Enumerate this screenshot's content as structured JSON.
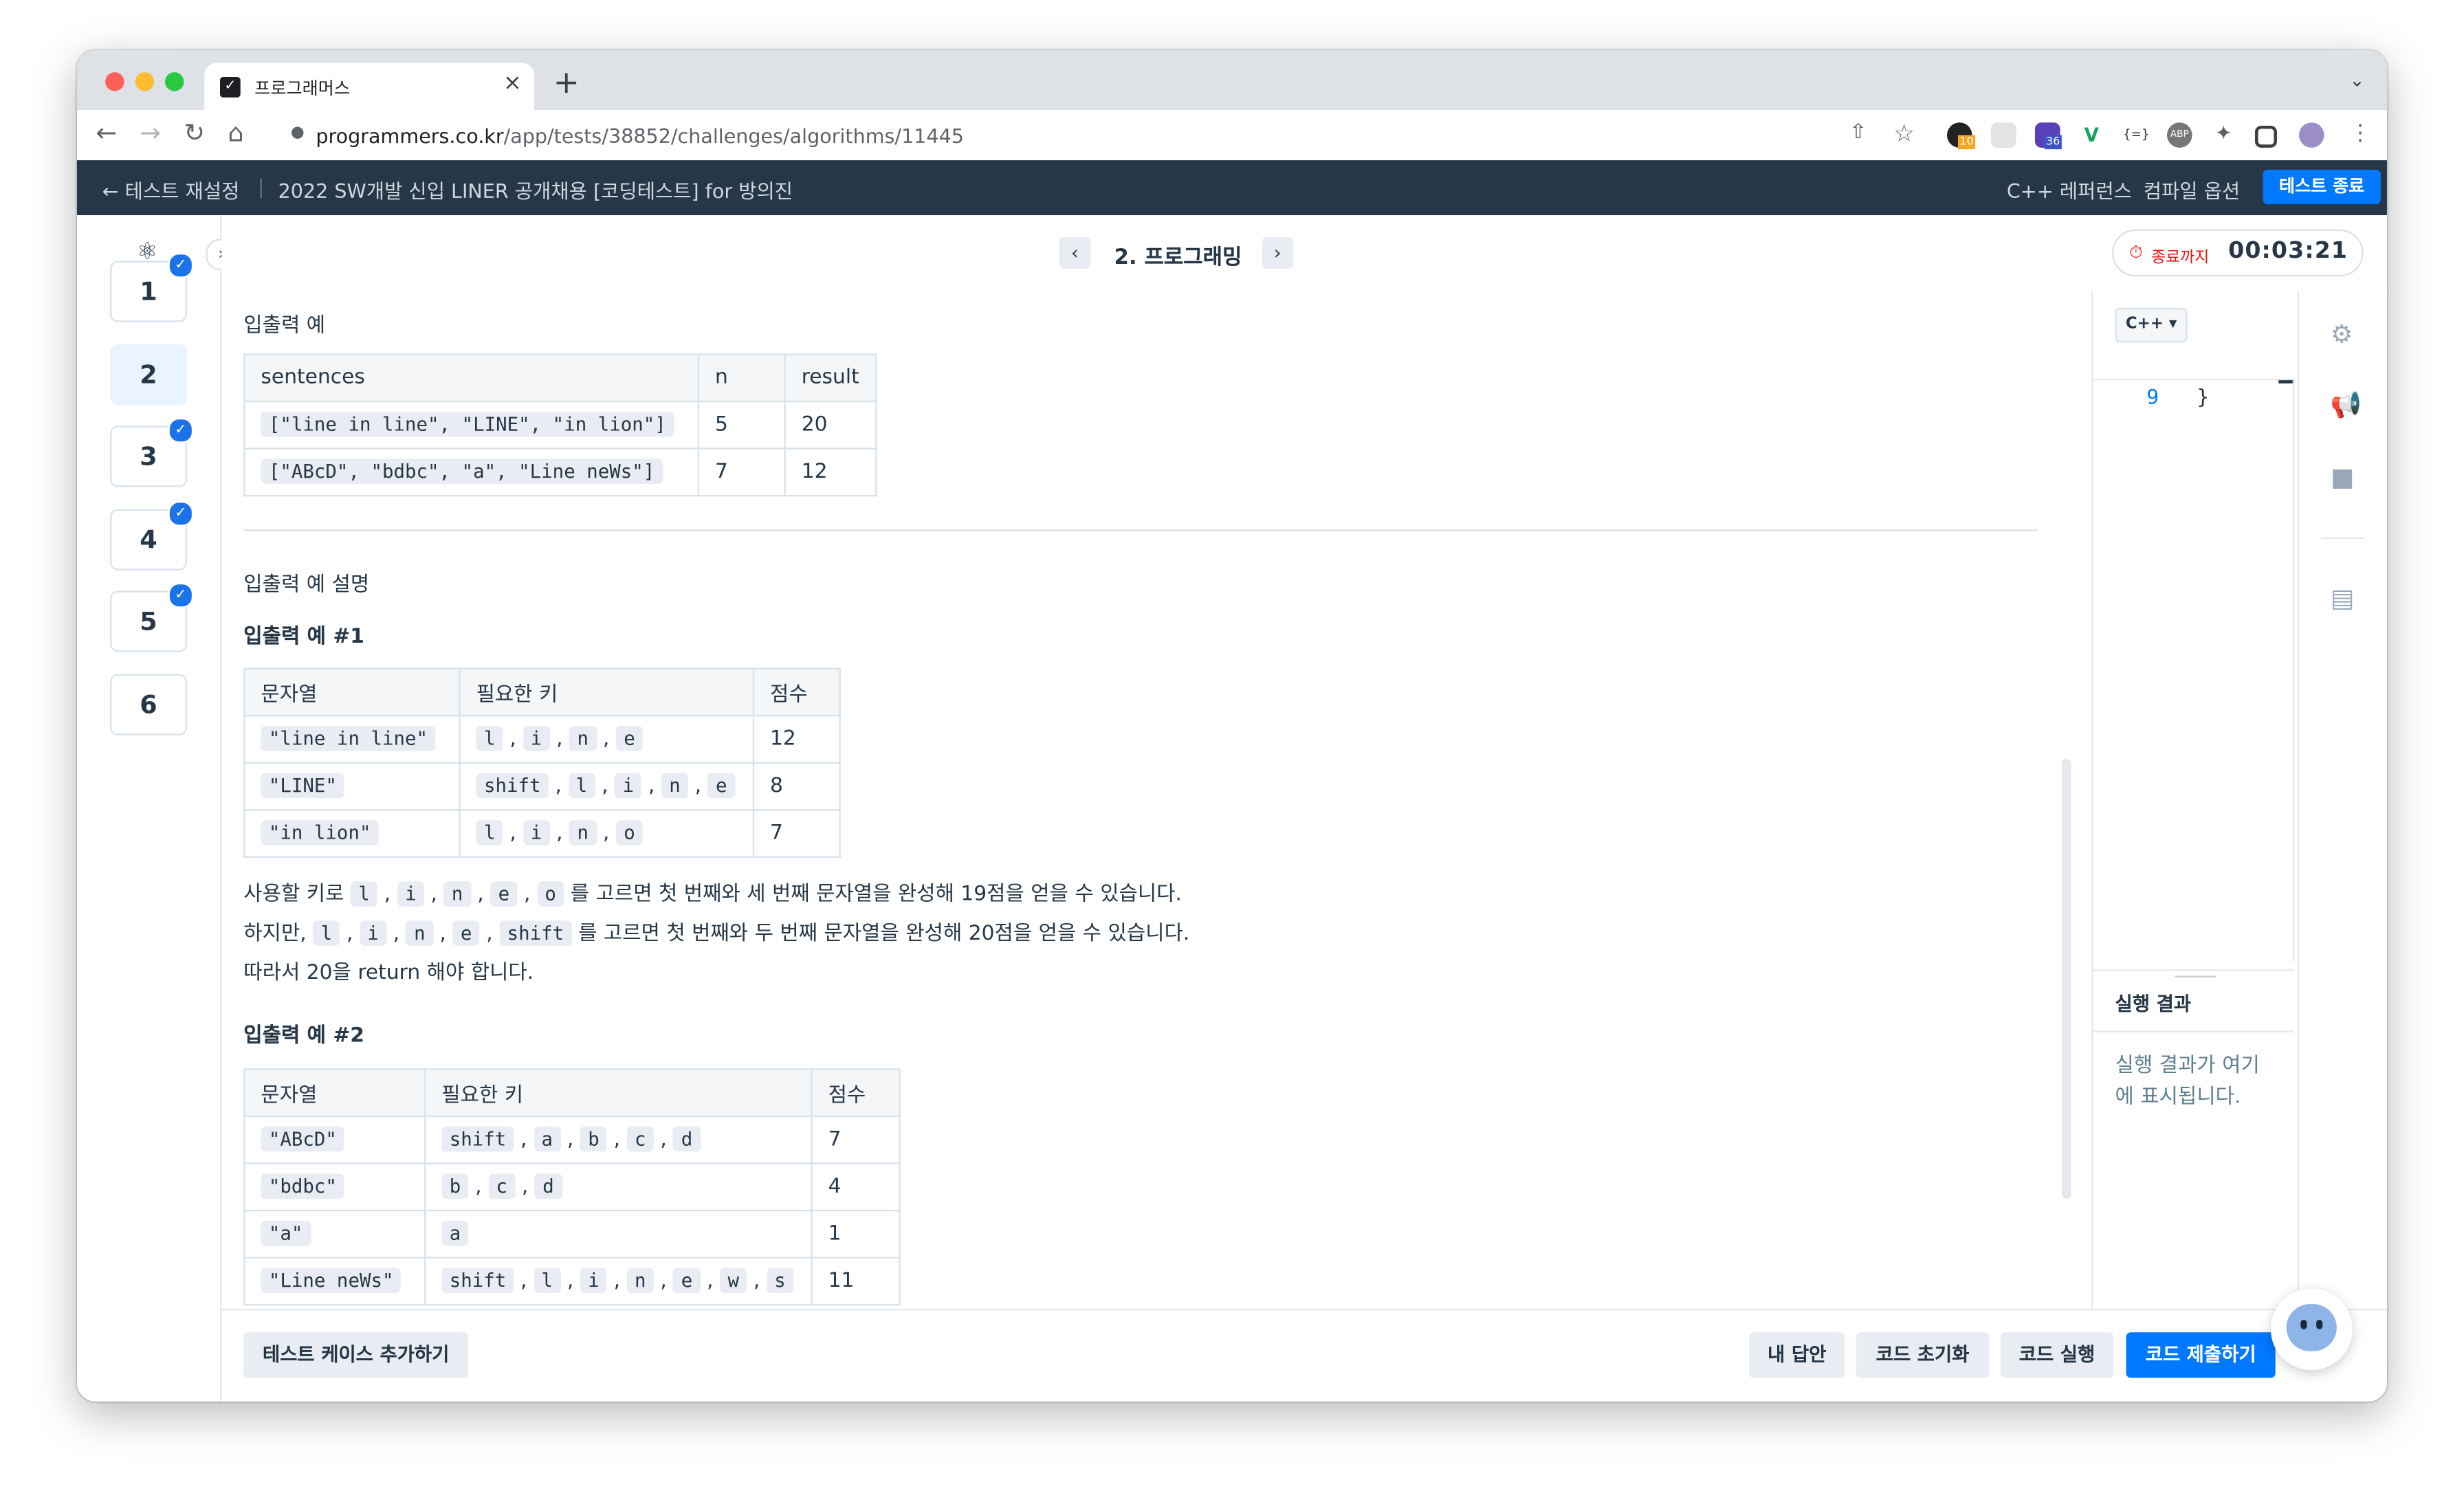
{
  "browser": {
    "tab_title": "프로그래머스",
    "url_host": "programmers.co.kr",
    "url_path": "/app/tests/38852/challenges/algorithms/11445",
    "extension_badges": [
      "10",
      "36"
    ]
  },
  "appbar": {
    "back_label": "테스트 재설정",
    "test_title": "2022 SW개발 신입 LINER 공개채용 [코딩테스트] for 방의진",
    "reference_label": "C++ 레퍼런스",
    "compile_label": "컴파일 옵션",
    "end_button": "테스트 종료"
  },
  "problems": {
    "items": [
      {
        "label": "1",
        "done": true
      },
      {
        "label": "2",
        "done": false
      },
      {
        "label": "3",
        "done": true
      },
      {
        "label": "4",
        "done": true
      },
      {
        "label": "5",
        "done": true
      },
      {
        "label": "6",
        "done": false
      }
    ],
    "active_index": 1
  },
  "header": {
    "title": "2. 프로그래밍",
    "timer_label": "종료까지",
    "timer_value": "00:03:21"
  },
  "content": {
    "io_example_heading": "입출력 예",
    "io_table": {
      "headers": [
        "sentences",
        "n",
        "result"
      ],
      "rows": [
        [
          "[\"line in line\", \"LINE\", \"in lion\"]",
          "5",
          "20"
        ],
        [
          "[\"ABcD\", \"bdbc\", \"a\", \"Line neWs\"]",
          "7",
          "12"
        ]
      ]
    },
    "explanation_heading": "입출력 예 설명",
    "example1_heading": "입출력 예 #1",
    "example1_table": {
      "headers": [
        "문자열",
        "필요한 키",
        "점수"
      ],
      "rows": [
        {
          "str": "\"line in line\"",
          "keys": [
            "l",
            "i",
            "n",
            "e"
          ],
          "score": "12"
        },
        {
          "str": "\"LINE\"",
          "keys": [
            "shift",
            "l",
            "i",
            "n",
            "e"
          ],
          "score": "8"
        },
        {
          "str": "\"in lion\"",
          "keys": [
            "l",
            "i",
            "n",
            "o"
          ],
          "score": "7"
        }
      ]
    },
    "paragraph1": {
      "prefix": "사용할 키로",
      "keys": [
        "l",
        "i",
        "n",
        "e",
        "o"
      ],
      "suffix": "를 고르면 첫 번째와 세 번째 문자열을 완성해 19점을 얻을 수 있습니다."
    },
    "paragraph2": {
      "prefix": "하지만,",
      "keys": [
        "l",
        "i",
        "n",
        "e",
        "shift"
      ],
      "suffix": "를 고르면 첫 번째와 두 번째 문자열을 완성해 20점을 얻을 수 있습니다."
    },
    "paragraph3": "따라서 20을 return 해야 합니다.",
    "example2_heading": "입출력 예 #2",
    "example2_table": {
      "headers": [
        "문자열",
        "필요한 키",
        "점수"
      ],
      "rows": [
        {
          "str": "\"ABcD\"",
          "keys": [
            "shift",
            "a",
            "b",
            "c",
            "d"
          ],
          "score": "7"
        },
        {
          "str": "\"bdbc\"",
          "keys": [
            "b",
            "c",
            "d"
          ],
          "score": "4"
        },
        {
          "str": "\"a\"",
          "keys": [
            "a"
          ],
          "score": "1"
        },
        {
          "str": "\"Line neWs\"",
          "keys": [
            "shift",
            "l",
            "i",
            "n",
            "e",
            "w",
            "s"
          ],
          "score": "11"
        }
      ]
    }
  },
  "editor": {
    "language": "C++",
    "line_number": "9",
    "code_line": "}",
    "results_heading": "실행 결과",
    "results_placeholder": "실행 결과가 여기에 표시됩니다."
  },
  "footer": {
    "add_testcase": "테스트 케이스 추가하기",
    "my_answer": "내 답안",
    "reset_code": "코드 초기화",
    "run_code": "코드 실행",
    "submit_code": "코드 제출하기"
  },
  "colors": {
    "accent": "#0078ff",
    "appbar_bg": "#263747",
    "text": "#263747",
    "timer_red": "#ee1111",
    "active_problem_bg": "#e9f4ff"
  }
}
